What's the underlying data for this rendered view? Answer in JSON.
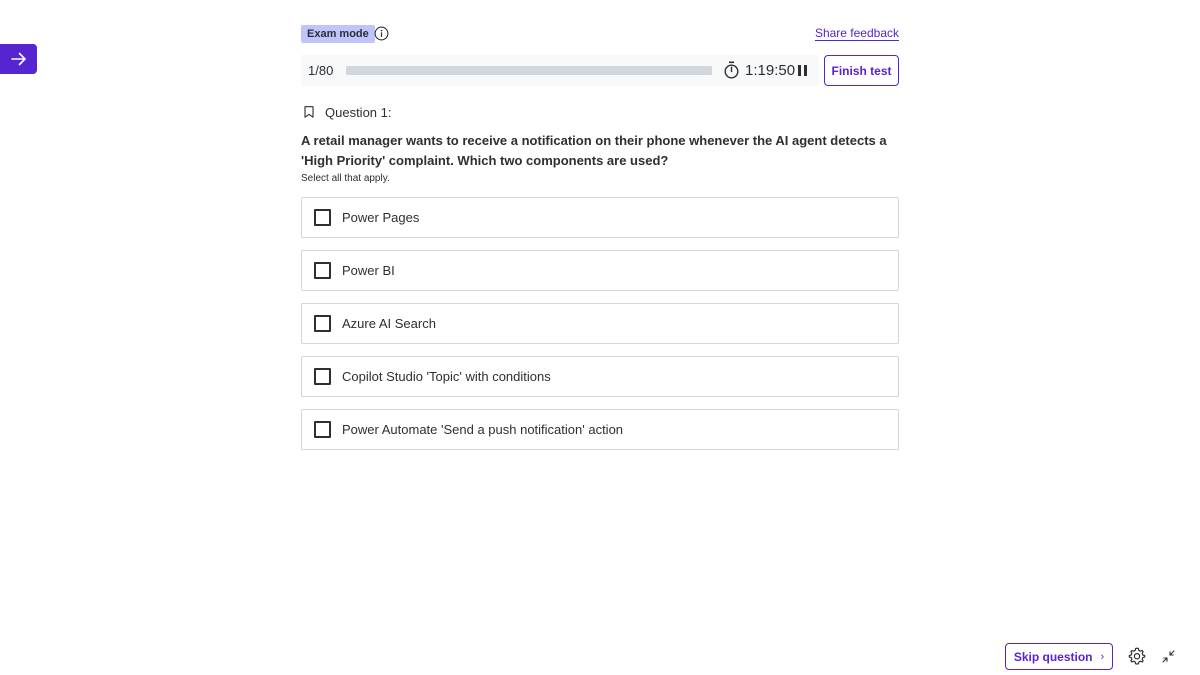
{
  "sidebar_toggle": {
    "icon": "arrow-right-icon",
    "color": "#5624d0"
  },
  "header": {
    "exam_badge": "Exam mode",
    "info_icon": "info-icon",
    "share_feedback": "Share feedback"
  },
  "status": {
    "counter": "1/80",
    "progress": 0.0,
    "timer_icon": "stopwatch-icon",
    "timer": "1:19:50",
    "pause_icon": "pause-icon",
    "finish_label": "Finish test"
  },
  "question": {
    "bookmark_icon": "bookmark-icon",
    "label": "Question 1:",
    "text": "A retail manager wants to receive a notification on their phone whenever the AI agent detects a 'High Priority' complaint. Which two components are used?",
    "instruction": "Select all that apply.",
    "options": [
      {
        "label": "Power Pages",
        "checked": false
      },
      {
        "label": "Power BI",
        "checked": false
      },
      {
        "label": "Azure AI Search",
        "checked": false
      },
      {
        "label": "Copilot Studio 'Topic' with conditions",
        "checked": false
      },
      {
        "label": "Power Automate 'Send a push notification' action",
        "checked": false
      }
    ]
  },
  "footer": {
    "skip_label": "Skip question",
    "skip_icon": "chevron-right-icon",
    "settings_icon": "gear-icon",
    "collapse_icon": "collapse-icon"
  },
  "colors": {
    "accent": "#5624d0",
    "badge_bg": "#c0c4fc",
    "track": "#d1d7dc",
    "text": "#2d2f31"
  }
}
